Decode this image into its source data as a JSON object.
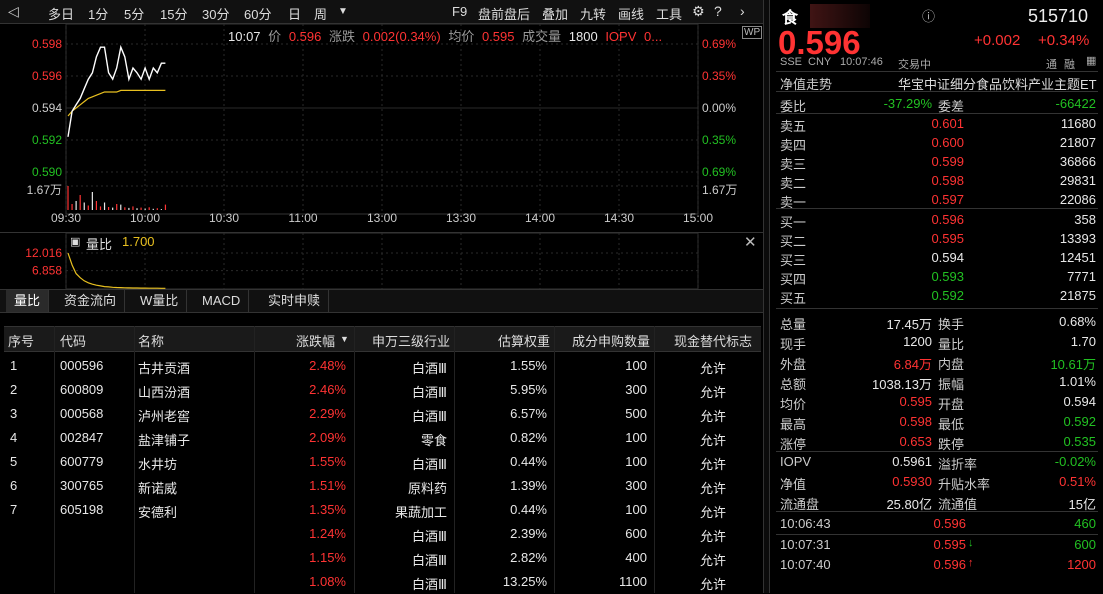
{
  "toolbar": {
    "periods": [
      "多日",
      "1分",
      "5分",
      "15分",
      "30分",
      "60分",
      "日",
      "周"
    ],
    "right_items": [
      "F9",
      "盘前盘后",
      "叠加",
      "九转",
      "画线",
      "工具"
    ]
  },
  "chart": {
    "info": {
      "time": "10:07",
      "price_label": "价",
      "price": "0.596",
      "change_label": "涨跌",
      "change": "0.002(0.34%)",
      "avg_label": "均价",
      "avg": "0.595",
      "volume_label": "成交量",
      "volume": "1800",
      "iopv_label": "IOPV",
      "iopv": "0..."
    },
    "y_left": [
      "0.598",
      "0.596",
      "0.594",
      "0.592",
      "0.590",
      "1.67万"
    ],
    "y_right": [
      "0.69%",
      "0.35%",
      "0.00%",
      "0.35%",
      "0.69%",
      "1.67万"
    ],
    "x_ticks": [
      "09:30",
      "10:00",
      "10:30",
      "11:00",
      "13:00",
      "13:30",
      "14:00",
      "14:30",
      "15:00"
    ],
    "price_series": [
      0.5922,
      0.5938,
      0.5942,
      0.5946,
      0.5952,
      0.5958,
      0.5962,
      0.5972,
      0.5978,
      0.5978,
      0.5962,
      0.5958,
      0.5965,
      0.5978,
      0.5972,
      0.5958,
      0.5965,
      0.5962,
      0.5958,
      0.5965,
      0.5958,
      0.5965,
      0.5962,
      0.5968,
      0.5968
    ],
    "avg_series": [
      0.5935,
      0.5938,
      0.594,
      0.5942,
      0.5944,
      0.5946,
      0.5947,
      0.5948,
      0.5949,
      0.595,
      0.595,
      0.595,
      0.595,
      0.5951,
      0.5951,
      0.5951,
      0.5951,
      0.5951,
      0.5951,
      0.5951,
      0.5951,
      0.5951,
      0.5951,
      0.5951,
      0.5951
    ],
    "volume_series": [
      8000,
      2000,
      3000,
      5000,
      2500,
      1500,
      6000,
      3000,
      1200,
      2500,
      1000,
      800,
      2000,
      1800,
      900,
      700,
      1200,
      600,
      800,
      500,
      900,
      400,
      600,
      300,
      1800
    ],
    "volume_colors": [
      "#ff3333",
      "#ff3333",
      "#e8e8e8",
      "#ff3333",
      "#e8e8e8",
      "#ff3333",
      "#e8e8e8",
      "#ff3333",
      "#ff3333",
      "#e8e8e8",
      "#ff3333",
      "#e8e8e8",
      "#ff3333",
      "#e8e8e8",
      "#ff3333",
      "#e8e8e8",
      "#ff3333",
      "#e8e8e8",
      "#ff3333",
      "#e8e8e8",
      "#ff3333",
      "#e8e8e8",
      "#ff3333",
      "#e8e8e8",
      "#ff3333"
    ]
  },
  "sub": {
    "label": "量比",
    "value": "1.700",
    "y_labels": [
      "12.016",
      "6.858"
    ],
    "series": [
      12.0,
      8.5,
      6.0,
      4.8,
      3.9,
      3.3,
      2.9,
      2.6,
      2.4,
      2.2,
      2.1,
      2.0,
      1.95,
      1.9,
      1.85,
      1.82,
      1.8,
      1.78,
      1.76,
      1.75,
      1.74,
      1.73,
      1.72,
      1.71,
      1.7
    ]
  },
  "tabs": [
    "量比",
    "资金流向",
    "W量比",
    "MACD",
    "实时申赎"
  ],
  "table": {
    "headers": [
      "序号",
      "代码",
      "名称",
      "涨跌幅",
      "申万三级行业",
      "估算权重",
      "成分申购数量",
      "现金替代标志"
    ],
    "rows": [
      {
        "no": "1",
        "code": "000596",
        "name": "古井贡酒",
        "chg": "2.48%",
        "ind": "白酒Ⅲ",
        "w": "1.55%",
        "qty": "100",
        "flag": "允许"
      },
      {
        "no": "2",
        "code": "600809",
        "name": "山西汾酒",
        "chg": "2.46%",
        "ind": "白酒Ⅲ",
        "w": "5.95%",
        "qty": "300",
        "flag": "允许"
      },
      {
        "no": "3",
        "code": "000568",
        "name": "泸州老窖",
        "chg": "2.29%",
        "ind": "白酒Ⅲ",
        "w": "6.57%",
        "qty": "500",
        "flag": "允许"
      },
      {
        "no": "4",
        "code": "002847",
        "name": "盐津铺子",
        "chg": "2.09%",
        "ind": "零食",
        "w": "0.82%",
        "qty": "100",
        "flag": "允许"
      },
      {
        "no": "5",
        "code": "600779",
        "name": "水井坊",
        "chg": "1.55%",
        "ind": "白酒Ⅲ",
        "w": "0.44%",
        "qty": "100",
        "flag": "允许"
      },
      {
        "no": "6",
        "code": "300765",
        "name": "新诺威",
        "chg": "1.51%",
        "ind": "原料药",
        "w": "1.39%",
        "qty": "300",
        "flag": "允许"
      },
      {
        "no": "7",
        "code": "605198",
        "name": "安德利",
        "chg": "1.35%",
        "ind": "果蔬加工",
        "w": "0.44%",
        "qty": "100",
        "flag": "允许"
      },
      {
        "no": "",
        "code": "",
        "name": "",
        "chg": "1.24%",
        "ind": "白酒Ⅲ",
        "w": "2.39%",
        "qty": "600",
        "flag": "允许"
      },
      {
        "no": "",
        "code": "",
        "name": "",
        "chg": "1.15%",
        "ind": "白酒Ⅲ",
        "w": "2.82%",
        "qty": "400",
        "flag": "允许"
      },
      {
        "no": "",
        "code": "",
        "name": "",
        "chg": "1.08%",
        "ind": "白酒Ⅲ",
        "w": "13.25%",
        "qty": "1100",
        "flag": "允许"
      }
    ]
  },
  "quote": {
    "short_name": "食",
    "code": "515710",
    "price": "0.596",
    "change": "+0.002",
    "change_pct": "+0.34%",
    "exchange": "SSE",
    "currency": "CNY",
    "time": "10:07:46",
    "status": "交易中",
    "tags": [
      "通",
      "融"
    ],
    "nav_trend_label": "净值走势",
    "fund_name": "华宝中证细分食品饮料产业主题ET",
    "webi_label": "委比",
    "webi": "-37.29%",
    "weicha_label": "委差",
    "weicha": "-66422",
    "asks": [
      {
        "label": "卖五",
        "price": "0.601",
        "vol": "11680"
      },
      {
        "label": "卖四",
        "price": "0.600",
        "vol": "21807"
      },
      {
        "label": "卖三",
        "price": "0.599",
        "vol": "36866"
      },
      {
        "label": "卖二",
        "price": "0.598",
        "vol": "29831"
      },
      {
        "label": "卖一",
        "price": "0.597",
        "vol": "22086"
      }
    ],
    "bids": [
      {
        "label": "买一",
        "price": "0.596",
        "vol": "358"
      },
      {
        "label": "买二",
        "price": "0.595",
        "vol": "13393"
      },
      {
        "label": "买三",
        "price": "0.594",
        "vol": "12451"
      },
      {
        "label": "买四",
        "price": "0.593",
        "vol": "7771"
      },
      {
        "label": "买五",
        "price": "0.592",
        "vol": "21875"
      }
    ],
    "stats": [
      {
        "l1": "总量",
        "v1": "17.45万",
        "c1": "white",
        "l2": "换手",
        "v2": "0.68%",
        "c2": "white"
      },
      {
        "l1": "现手",
        "v1": "1200",
        "c1": "white",
        "l2": "量比",
        "v2": "1.70",
        "c2": "white"
      },
      {
        "l1": "外盘",
        "v1": "6.84万",
        "c1": "red",
        "l2": "内盘",
        "v2": "10.61万",
        "c2": "green"
      },
      {
        "l1": "总额",
        "v1": "1038.13万",
        "c1": "white",
        "l2": "振幅",
        "v2": "1.01%",
        "c2": "white"
      },
      {
        "l1": "均价",
        "v1": "0.595",
        "c1": "red",
        "l2": "开盘",
        "v2": "0.594",
        "c2": "white"
      },
      {
        "l1": "最高",
        "v1": "0.598",
        "c1": "red",
        "l2": "最低",
        "v2": "0.592",
        "c2": "green"
      },
      {
        "l1": "涨停",
        "v1": "0.653",
        "c1": "red",
        "l2": "跌停",
        "v2": "0.535",
        "c2": "green"
      }
    ],
    "stats2": [
      {
        "l1": "IOPV",
        "v1": "0.5961",
        "c1": "white",
        "l2": "溢折率",
        "v2": "-0.02%",
        "c2": "green"
      },
      {
        "l1": "净值",
        "v1": "0.5930",
        "c1": "red",
        "l2": "升贴水率",
        "v2": "0.51%",
        "c2": "red"
      },
      {
        "l1": "流通盘",
        "v1": "25.80亿",
        "c1": "white",
        "l2": "流通值",
        "v2": "15亿",
        "c2": "white"
      }
    ],
    "ticks": [
      {
        "time": "10:06:43",
        "price": "0.596",
        "dir": "",
        "vol": "460",
        "vc": "green"
      },
      {
        "time": "10:07:31",
        "price": "0.595",
        "dir": "down",
        "vol": "600",
        "vc": "green"
      },
      {
        "time": "10:07:40",
        "price": "0.596",
        "dir": "up",
        "vol": "1200",
        "vc": "red"
      }
    ]
  }
}
